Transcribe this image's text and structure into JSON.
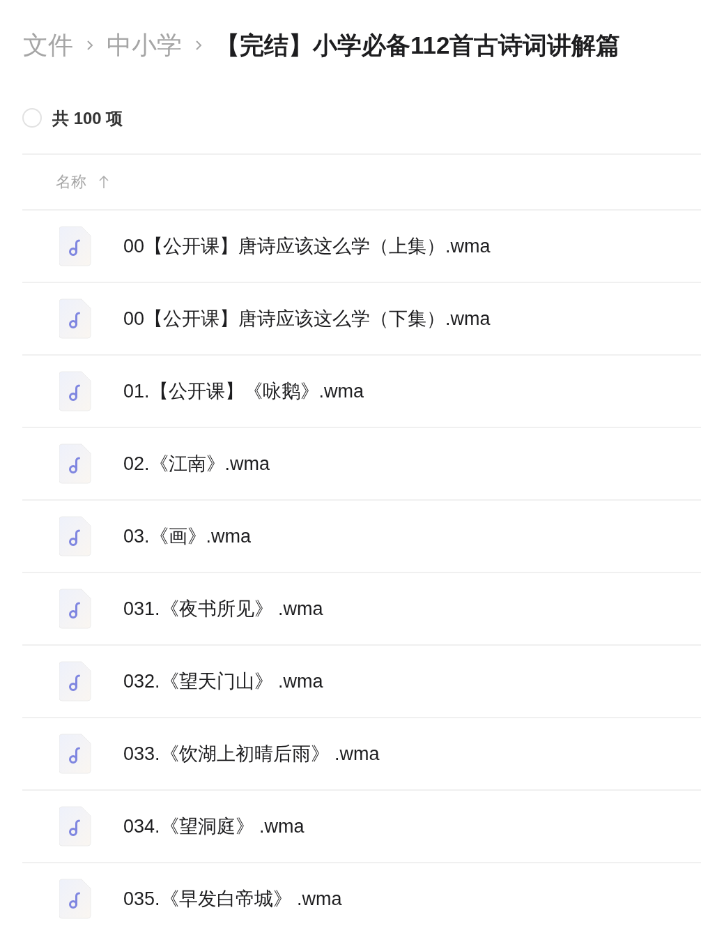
{
  "breadcrumb": [
    {
      "label": "文件",
      "current": false
    },
    {
      "label": "中小学",
      "current": false
    },
    {
      "label": "【完结】小学必备112首古诗词讲解篇",
      "current": true
    }
  ],
  "selection": {
    "checked": false,
    "count_label": "共 100 项"
  },
  "table": {
    "columns": [
      {
        "label": "名称",
        "sorted_ascending": true
      }
    ],
    "rows": [
      {
        "name": "00【公开课】唐诗应该这么学（上集）.wma",
        "kind": "audio"
      },
      {
        "name": "00【公开课】唐诗应该这么学（下集）.wma",
        "kind": "audio"
      },
      {
        "name": "01.【公开课】《咏鹅》.wma",
        "kind": "audio"
      },
      {
        "name": "02.《江南》.wma",
        "kind": "audio"
      },
      {
        "name": "03.《画》.wma",
        "kind": "audio"
      },
      {
        "name": "031.《夜书所见》 .wma",
        "kind": "audio"
      },
      {
        "name": "032.《望天门山》 .wma",
        "kind": "audio"
      },
      {
        "name": "033.《饮湖上初晴后雨》 .wma",
        "kind": "audio"
      },
      {
        "name": "034.《望洞庭》 .wma",
        "kind": "audio"
      },
      {
        "name": "035.《早发白帝城》 .wma",
        "kind": "audio"
      }
    ]
  }
}
